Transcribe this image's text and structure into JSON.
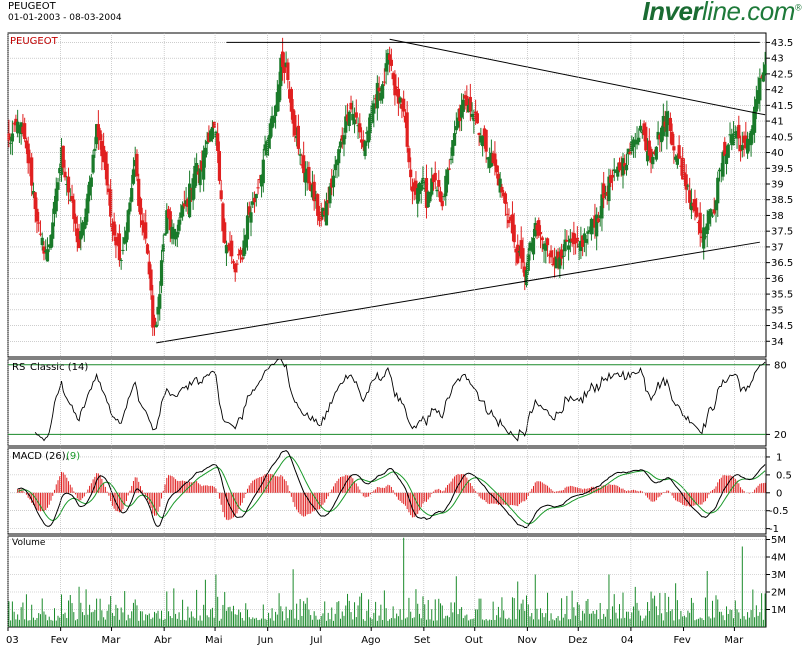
{
  "header": {
    "symbol": "PEUGEOT",
    "range": "01-01-2003 - 08-03-2004",
    "brand_bold": "Inver",
    "brand_rest": "line.com",
    "brand_reg": "®"
  },
  "colors": {
    "up": "#1a7a2a",
    "down": "#e02020",
    "grid": "#b0b0b0",
    "rsi_line": "#000000",
    "rsi_bounds": "#1a8a2a",
    "macd_line": "#000000",
    "signal_line": "#1a9a2a",
    "volume": "#1a8a2a",
    "title_red": "#c00000"
  },
  "chart_data": [
    {
      "type": "candlestick",
      "title": "PEUGEOT",
      "ylim": [
        33.5,
        43.8
      ],
      "y_ticks": [
        "34",
        "34.5",
        "35",
        "35.5",
        "36",
        "36.5",
        "37",
        "37.5",
        "38",
        "38.5",
        "39",
        "39.5",
        "40",
        "40.5",
        "41",
        "41.5",
        "42",
        "42.5",
        "43",
        "43.5"
      ],
      "x_labels": [
        "03",
        "Fev",
        "Mar",
        "Abr",
        "Mai",
        "Jun",
        "Jul",
        "Ago",
        "Set",
        "Out",
        "Nov",
        "Dez",
        "04",
        "Fev",
        "Mar"
      ],
      "close_anchors": [
        [
          0,
          40.3
        ],
        [
          6,
          41.0
        ],
        [
          12,
          39.5
        ],
        [
          18,
          37.2
        ],
        [
          22,
          36.8
        ],
        [
          26,
          38.2
        ],
        [
          30,
          40.0
        ],
        [
          35,
          38.5
        ],
        [
          40,
          37.0
        ],
        [
          45,
          38.5
        ],
        [
          50,
          40.8
        ],
        [
          55,
          39.5
        ],
        [
          58,
          38.0
        ],
        [
          62,
          37.0
        ],
        [
          64,
          36.7
        ],
        [
          68,
          38.0
        ],
        [
          72,
          39.7
        ],
        [
          75,
          38.0
        ],
        [
          79,
          36.9
        ],
        [
          82,
          34.6
        ],
        [
          84,
          34.3
        ],
        [
          87,
          36.5
        ],
        [
          90,
          38.0
        ],
        [
          94,
          37.3
        ],
        [
          98,
          38.0
        ],
        [
          102,
          38.5
        ],
        [
          106,
          39.6
        ],
        [
          109,
          39.3
        ],
        [
          112,
          40.2
        ],
        [
          115,
          40.8
        ],
        [
          118,
          40.5
        ],
        [
          122,
          37.6
        ],
        [
          125,
          37.0
        ],
        [
          129,
          36.2
        ],
        [
          133,
          36.8
        ],
        [
          136,
          37.9
        ],
        [
          140,
          38.5
        ],
        [
          144,
          39.5
        ],
        [
          148,
          40.5
        ],
        [
          152,
          41.5
        ],
        [
          155,
          42.8
        ],
        [
          158,
          42.8
        ],
        [
          161,
          41.5
        ],
        [
          165,
          40.0
        ],
        [
          168,
          39.5
        ],
        [
          172,
          39.0
        ],
        [
          175,
          38.3
        ],
        [
          178,
          37.8
        ],
        [
          182,
          38.5
        ],
        [
          186,
          39.5
        ],
        [
          190,
          40.5
        ],
        [
          194,
          41.5
        ],
        [
          198,
          41.0
        ],
        [
          202,
          40.2
        ],
        [
          206,
          41.0
        ],
        [
          210,
          42.0
        ],
        [
          214,
          42.3
        ],
        [
          217,
          43.2
        ],
        [
          220,
          42.0
        ],
        [
          223,
          41.5
        ],
        [
          226,
          40.8
        ],
        [
          229,
          39.0
        ],
        [
          232,
          38.6
        ],
        [
          235,
          39.2
        ],
        [
          238,
          38.5
        ],
        [
          241,
          39.0
        ],
        [
          244,
          38.8
        ],
        [
          247,
          38.5
        ],
        [
          250,
          39.3
        ],
        [
          253,
          40.2
        ],
        [
          256,
          41.0
        ],
        [
          259,
          41.5
        ],
        [
          262,
          41.7
        ],
        [
          265,
          41.2
        ],
        [
          268,
          40.8
        ],
        [
          271,
          40.3
        ],
        [
          274,
          40.0
        ],
        [
          277,
          39.5
        ],
        [
          280,
          39.0
        ],
        [
          283,
          38.3
        ],
        [
          286,
          37.8
        ],
        [
          288,
          37.0
        ],
        [
          291,
          36.6
        ],
        [
          294,
          36.2
        ],
        [
          297,
          36.9
        ],
        [
          300,
          37.5
        ],
        [
          303,
          37.3
        ],
        [
          306,
          37.0
        ],
        [
          309,
          36.8
        ],
        [
          312,
          36.5
        ],
        [
          315,
          36.9
        ],
        [
          318,
          37.0
        ],
        [
          321,
          37.0
        ],
        [
          324,
          36.9
        ],
        [
          327,
          37.2
        ],
        [
          330,
          37.4
        ],
        [
          333,
          37.8
        ],
        [
          336,
          38.0
        ],
        [
          339,
          38.6
        ],
        [
          342,
          39.0
        ],
        [
          345,
          39.2
        ],
        [
          348,
          39.5
        ],
        [
          351,
          39.8
        ],
        [
          354,
          40.0
        ],
        [
          357,
          40.5
        ],
        [
          360,
          40.8
        ],
        [
          363,
          40.3
        ],
        [
          366,
          39.9
        ],
        [
          369,
          40.3
        ],
        [
          372,
          40.8
        ],
        [
          375,
          41.2
        ],
        [
          378,
          40.5
        ],
        [
          381,
          39.8
        ],
        [
          384,
          39.3
        ],
        [
          387,
          38.8
        ],
        [
          390,
          38.4
        ],
        [
          393,
          37.8
        ],
        [
          396,
          37.4
        ],
        [
          399,
          37.9
        ],
        [
          402,
          38.3
        ],
        [
          405,
          39.3
        ],
        [
          408,
          40.0
        ],
        [
          411,
          40.5
        ],
        [
          414,
          40.7
        ],
        [
          417,
          40.3
        ],
        [
          420,
          40.0
        ],
        [
          423,
          40.7
        ],
        [
          426,
          41.8
        ],
        [
          429,
          42.4
        ],
        [
          431,
          42.8
        ]
      ]
    },
    {
      "type": "line",
      "title": "RS",
      "subtitle": "Classic (14)",
      "ylim": [
        10,
        85
      ],
      "y_ticks": [
        "80",
        "20"
      ],
      "bounds": [
        80,
        20
      ]
    },
    {
      "type": "line",
      "title": "MACD (26),",
      "signal_label": "(9)",
      "ylim": [
        -1.15,
        1.25
      ],
      "y_ticks": [
        "1",
        "0.5",
        "0",
        "-0.5",
        "-1"
      ]
    },
    {
      "type": "bar",
      "title": "Volume",
      "ylim": [
        0,
        5200000
      ],
      "y_ticks": [
        "5M",
        "4M",
        "3M",
        "2M",
        "1M"
      ]
    }
  ]
}
